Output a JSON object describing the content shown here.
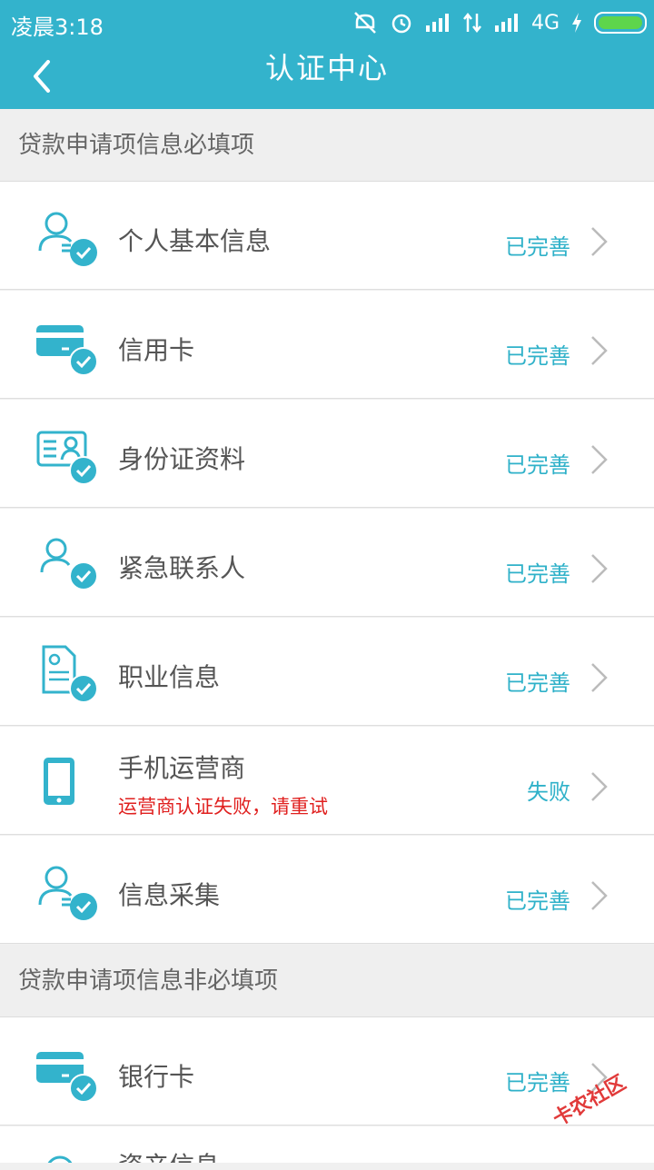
{
  "status_bar": {
    "time": "凌晨3:18",
    "network": "4G"
  },
  "header": {
    "title": "认证中心"
  },
  "sections": [
    {
      "label": "贷款申请项信息必填项"
    },
    {
      "label": "贷款申请项信息非必填项"
    }
  ],
  "items": [
    {
      "label": "个人基本信息",
      "status": "已完善",
      "icon": "person-icon"
    },
    {
      "label": "信用卡",
      "status": "已完善",
      "icon": "credit-card-icon"
    },
    {
      "label": "身份证资料",
      "status": "已完善",
      "icon": "id-card-icon"
    },
    {
      "label": "紧急联系人",
      "status": "已完善",
      "icon": "contact-icon"
    },
    {
      "label": "职业信息",
      "status": "已完善",
      "icon": "document-icon"
    },
    {
      "label": "手机运营商",
      "status": "失败",
      "sub": "运营商认证失败，请重试",
      "icon": "phone-icon"
    },
    {
      "label": "信息采集",
      "status": "已完善",
      "icon": "person-icon"
    },
    {
      "label": "银行卡",
      "status": "已完善",
      "icon": "bank-card-icon"
    },
    {
      "label": "资产信息",
      "status": "",
      "icon": "asset-icon"
    }
  ],
  "watermark": "卡农社区",
  "colors": {
    "accent": "#33b3cc",
    "status": "#2fb1c9",
    "error": "#e0201f"
  }
}
